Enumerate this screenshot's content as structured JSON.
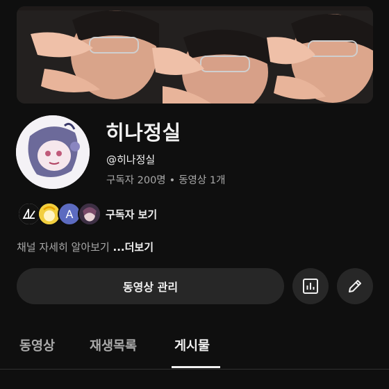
{
  "channel": {
    "name": "히나정실",
    "handle": "@히나정실",
    "subscribers": "구독자 200명",
    "separator": "•",
    "videos": "동영상 1개",
    "subscribers_link": "구독자 보기",
    "about_text": "채널 자세히 알아보기 ",
    "about_more": "...더보기"
  },
  "subscriber_avatars": [
    {
      "name": "subscriber-avatar-logo",
      "letter": ""
    },
    {
      "name": "subscriber-avatar-yellow",
      "letter": ""
    },
    {
      "name": "subscriber-avatar-letter",
      "letter": "A"
    },
    {
      "name": "subscriber-avatar-character",
      "letter": ""
    }
  ],
  "actions": {
    "manage_videos": "동영상 관리",
    "analytics_icon": "bar-chart-icon",
    "edit_icon": "pencil-icon"
  },
  "tabs": [
    {
      "label": "동영상",
      "active": false
    },
    {
      "label": "재생목록",
      "active": false
    },
    {
      "label": "게시물",
      "active": true
    }
  ],
  "colors": {
    "background": "#0f0f0f",
    "button": "#272727",
    "text_primary": "#f1f1f1",
    "text_secondary": "#aaaaaa",
    "subscriber_a": "#5c6bc0"
  }
}
